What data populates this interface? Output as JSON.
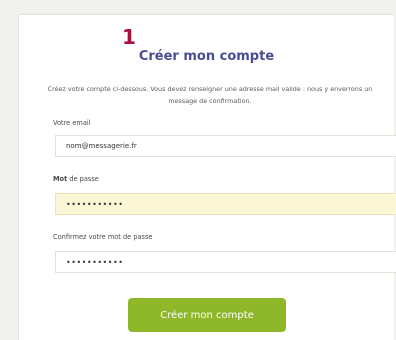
{
  "step_number": "1",
  "title": "Créer mon compte",
  "intro": "Créez votre compte ci-dessous. Vous devez renseigner une adresse mail valide : nous y enverrons un message de confirmation.",
  "email": {
    "label": "Votre email",
    "value": "nom@messagerie.fr"
  },
  "password": {
    "label_bold": "Mot",
    "label_rest": " de passe",
    "value": "•••••••••••"
  },
  "confirm": {
    "label": "Confirmez votre mot de passe",
    "value": "•••••••••••"
  },
  "submit_label": "Créer mon compte",
  "colors": {
    "step": "#a3133c",
    "title": "#4c4c95",
    "button": "#8eb82a",
    "focused_field": "#fbf6d6"
  }
}
